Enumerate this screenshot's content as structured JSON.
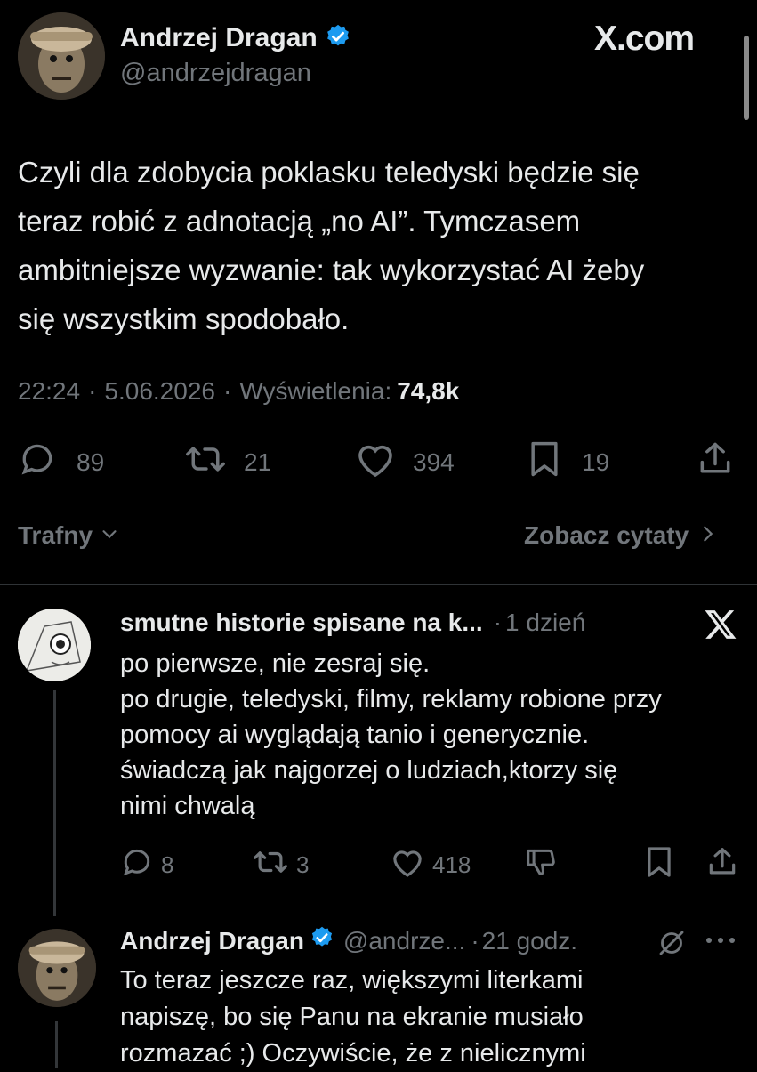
{
  "main_tweet": {
    "author_name": "Andrzej Dragan",
    "handle": "@andrzejdragan",
    "brand": "X.com",
    "text_lines": [
      "Czyli dla zdobycia poklasku teledyski będzie się",
      "teraz robić z adnotacją „no AI”. Tymczasem",
      "ambitniejsze wyzwanie: tak wykorzystać AI żeby",
      "się wszystkim spodobało."
    ],
    "time": "22:24",
    "date": "5.06.2026",
    "views_label": "Wyświetlenia:",
    "views_value": "74,8k",
    "replies": "89",
    "reposts": "21",
    "likes": "394",
    "bookmarks": "19"
  },
  "sort": {
    "label": "Trafny",
    "quotes_link": "Zobacz cytaty"
  },
  "reply1": {
    "author_name": "smutne historie spisane na k...",
    "time": "1 dzień",
    "text_lines": [
      "po pierwsze, nie zesraj się.",
      "po drugie, teledyski, filmy, reklamy robione przy",
      "pomocy ai wyglądają tanio i generycznie.",
      "świadczą jak najgorzej o ludziach,ktorzy się",
      "nimi chwalą"
    ],
    "replies": "8",
    "reposts": "3",
    "likes": "418"
  },
  "reply2": {
    "author_name": "Andrzej Dragan",
    "handle": "@andrze...",
    "time": "21 godz.",
    "text_lines": [
      "To teraz jeszcze raz, większymi literkami",
      "napiszę, bo się Panu na ekranie musiało",
      "rozmazać ;) Oczywiście, że z nielicznymi"
    ]
  }
}
